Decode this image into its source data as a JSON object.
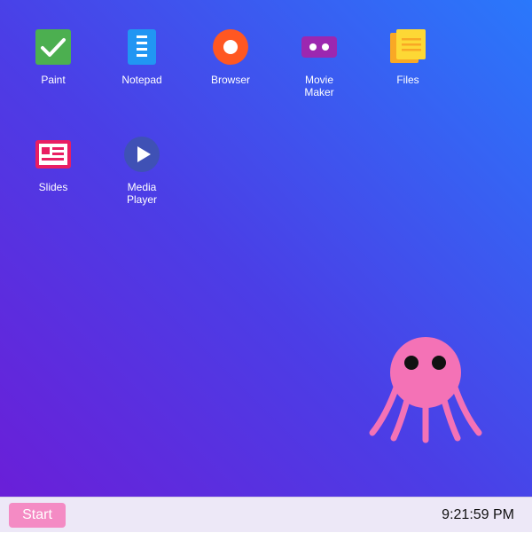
{
  "desktop": {
    "icons": [
      {
        "label": "Paint",
        "icon": "check-icon",
        "color": "#4caf50"
      },
      {
        "label": "Notepad",
        "icon": "notepad-icon",
        "color": "#2196f3"
      },
      {
        "label": "Browser",
        "icon": "browser-icon",
        "color": "#ff5722"
      },
      {
        "label": "Movie\nMaker",
        "icon": "movie-icon",
        "color": "#9c27b0"
      },
      {
        "label": "Files",
        "icon": "folder-icon",
        "color": "#fbc02d"
      },
      {
        "label": "Slides",
        "icon": "slides-icon",
        "color": "#e91e63"
      },
      {
        "label": "Media\nPlayer",
        "icon": "play-icon",
        "color": "#3f51b5"
      }
    ],
    "mascot": {
      "name": "octopus-mascot",
      "color": "#f472b6"
    }
  },
  "taskbar": {
    "start_label": "Start",
    "clock": "9:21:59 PM"
  }
}
